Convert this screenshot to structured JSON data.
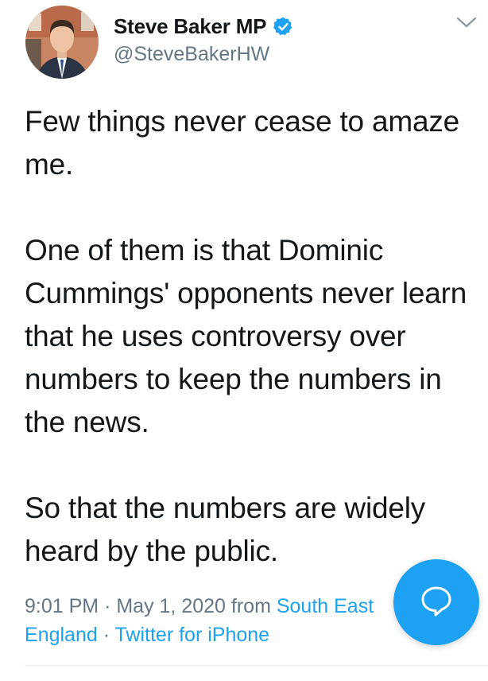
{
  "author": {
    "display_name": "Steve Baker MP",
    "handle": "@SteveBakerHW",
    "verified": true
  },
  "tweet": {
    "text": "Few things never cease to amaze me.\n\nOne of them is that Dominic Cummings' opponents never learn that he uses controversy over numbers to keep the numbers in the news.\n\nSo that the numbers are widely heard by the public."
  },
  "meta": {
    "time": "9:01 PM",
    "separator": "·",
    "date": "May 1, 2020",
    "from_label": "from",
    "location": "South East England",
    "source": "Twitter for iPhone"
  },
  "icons": {
    "verified": "verified-badge-icon",
    "caret": "chevron-down-icon",
    "compose": "chat-bubble-icon"
  },
  "colors": {
    "accent": "#1da1f2",
    "text": "#14171a",
    "secondary": "#657786",
    "divider": "#e1e8ed"
  }
}
